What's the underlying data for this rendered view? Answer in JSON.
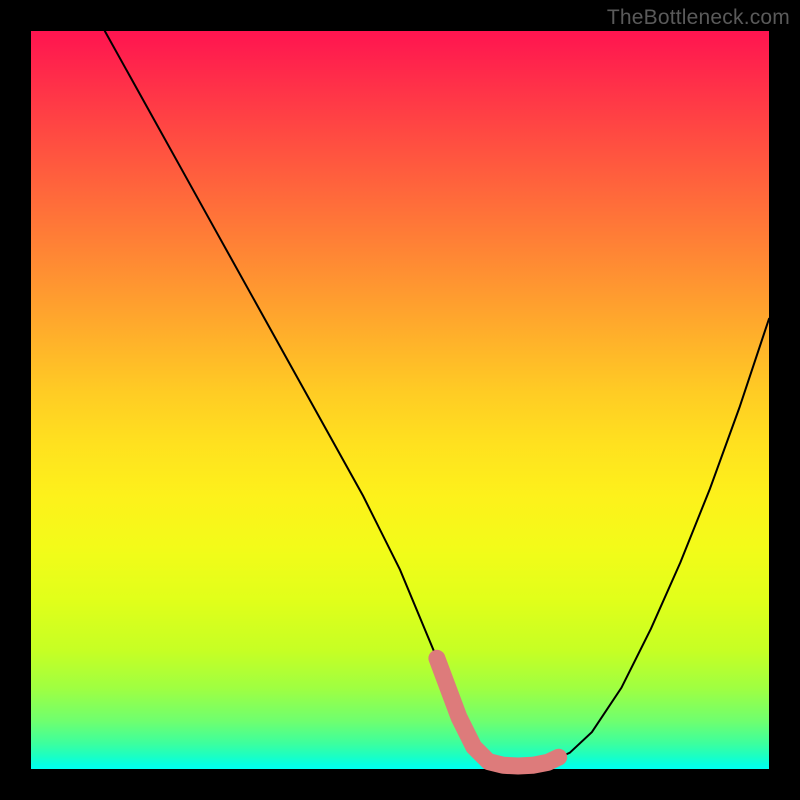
{
  "watermark": "TheBottleneck.com",
  "chart_data": {
    "type": "line",
    "title": "",
    "xlabel": "",
    "ylabel": "",
    "xlim": [
      0,
      100
    ],
    "ylim": [
      0,
      100
    ],
    "grid": false,
    "series": [
      {
        "name": "curve",
        "x": [
          10,
          15,
          20,
          25,
          30,
          35,
          40,
          45,
          50,
          55,
          58,
          60,
          62,
          64,
          66,
          68,
          70,
          73,
          76,
          80,
          84,
          88,
          92,
          96,
          100
        ],
        "values": [
          100,
          91,
          82,
          73,
          64,
          55,
          46,
          37,
          27,
          15,
          7,
          3,
          1,
          0.5,
          0.4,
          0.5,
          0.9,
          2.2,
          5,
          11,
          19,
          28,
          38,
          49,
          61
        ]
      }
    ],
    "highlight": {
      "name": "bottom-overlay",
      "color": "#dd7b7b",
      "x": [
        55,
        58,
        60,
        62,
        64,
        66,
        68,
        70,
        71.5
      ],
      "values": [
        15,
        7,
        3,
        1,
        0.5,
        0.4,
        0.5,
        0.9,
        1.6
      ]
    },
    "background_gradient": {
      "direction": "vertical",
      "stops": [
        {
          "pos": 0.0,
          "color": "#ff1450"
        },
        {
          "pos": 0.5,
          "color": "#ffcc24"
        },
        {
          "pos": 0.8,
          "color": "#d8ff1e"
        },
        {
          "pos": 1.0,
          "color": "#00fff3"
        }
      ]
    }
  }
}
